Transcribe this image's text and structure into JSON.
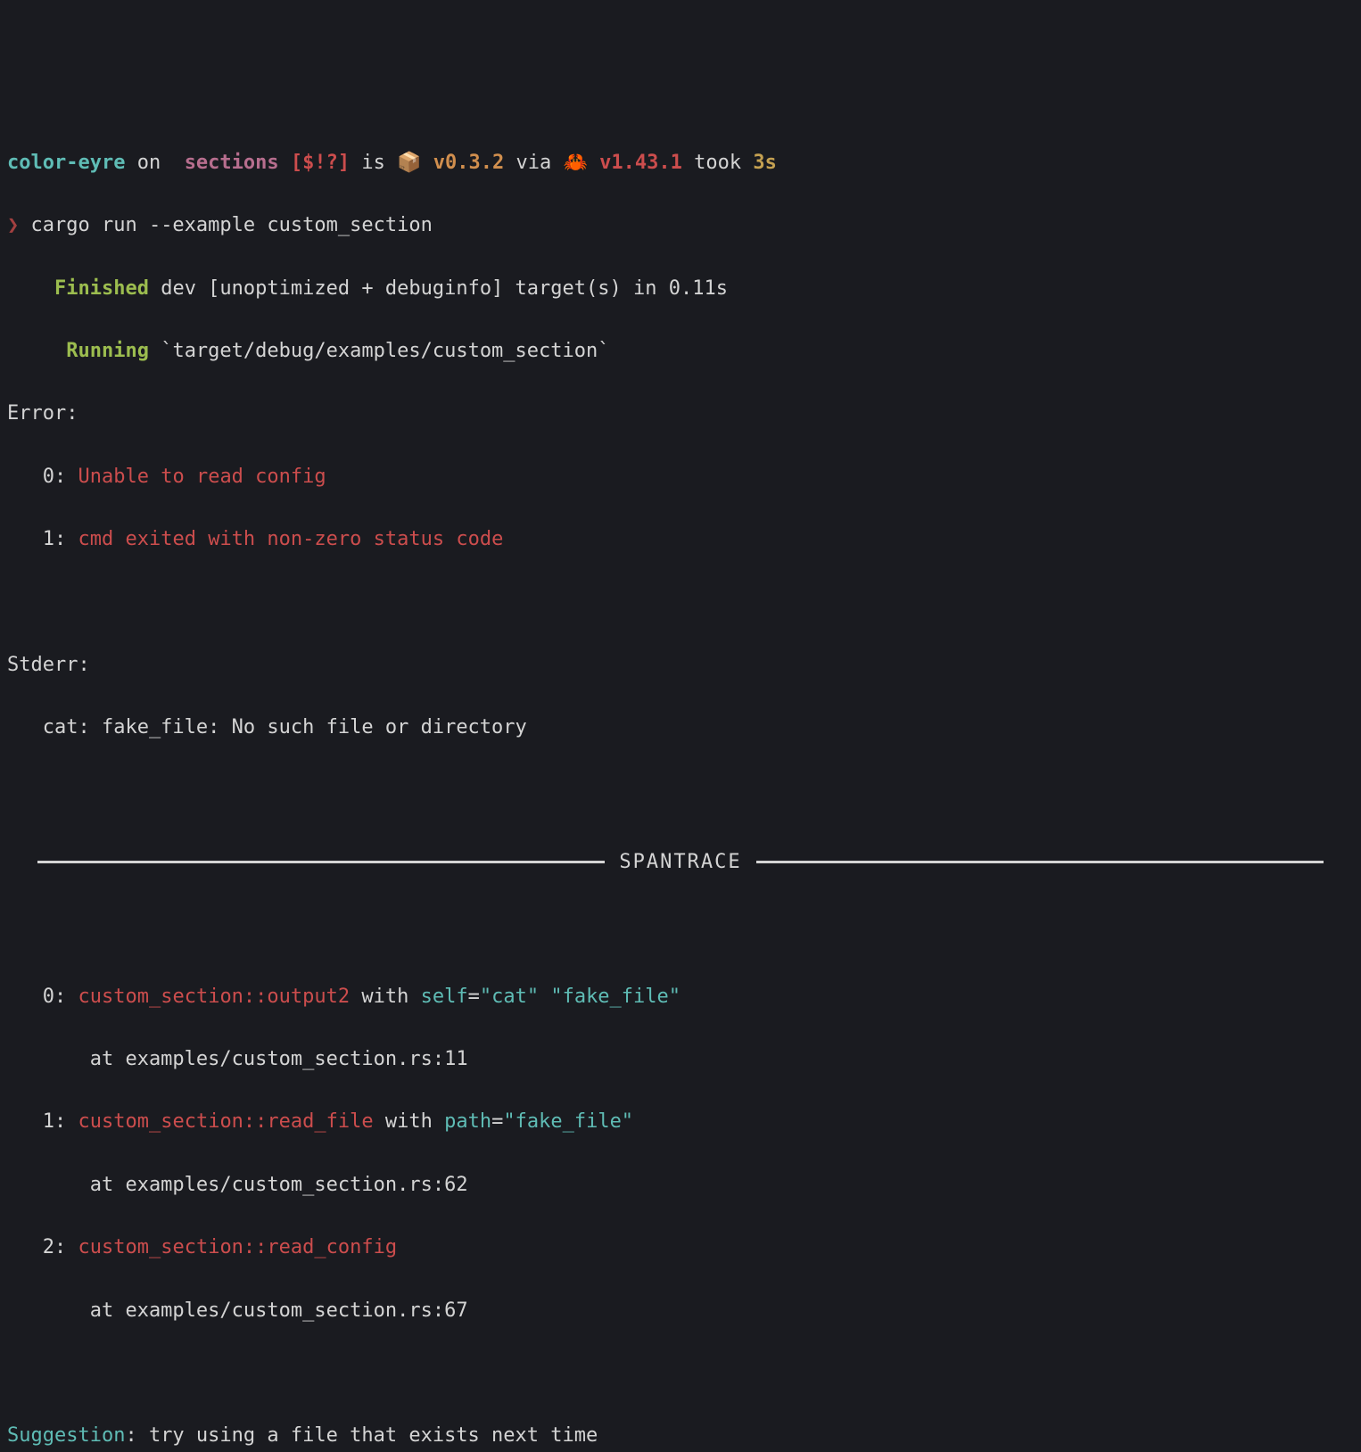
{
  "prompt": {
    "project": "color-eyre",
    "on": " on ",
    "branch_icon": "",
    "branch": "sections",
    "git_status": " [$!?]",
    "is": " is ",
    "pkg_icon": "📦 ",
    "pkg_version": "v0.3.2",
    "via": " via ",
    "rust_icon": "🦀 ",
    "rust_version": "v1.43.1",
    "took": " took ",
    "duration": "3s"
  },
  "command": {
    "symbol": "❯",
    "text": " cargo run --example custom_section"
  },
  "cargo": {
    "finished_label": "Finished",
    "finished_text": " dev [unoptimized + debuginfo] target(s) in 0.11s",
    "running_label": "Running",
    "running_text": " `target/debug/examples/custom_section`"
  },
  "error": {
    "header": "Error:",
    "items": [
      {
        "idx": "0: ",
        "msg": "Unable to read config"
      },
      {
        "idx": "1: ",
        "msg": "cmd exited with non-zero status code"
      }
    ]
  },
  "stderr": {
    "header": "Stderr:",
    "body": "   cat: fake_file: No such file or directory"
  },
  "spantrace": {
    "label": "SPANTRACE",
    "entries": [
      {
        "idx": "0: ",
        "func": "custom_section::output2",
        "with": " with ",
        "field": "self",
        "eq": "=",
        "val": "\"cat\" \"fake_file\"",
        "at": "       at examples/custom_section.rs:11"
      },
      {
        "idx": "1: ",
        "func": "custom_section::read_file",
        "with": " with ",
        "field": "path",
        "eq": "=",
        "val": "\"fake_file\"",
        "at": "       at examples/custom_section.rs:62"
      },
      {
        "idx": "2: ",
        "func": "custom_section::read_config",
        "with": "",
        "field": "",
        "eq": "",
        "val": "",
        "at": "       at examples/custom_section.rs:67"
      }
    ]
  },
  "suggestion": {
    "label": "Suggestion",
    "text": ": try using a file that exists next time"
  }
}
